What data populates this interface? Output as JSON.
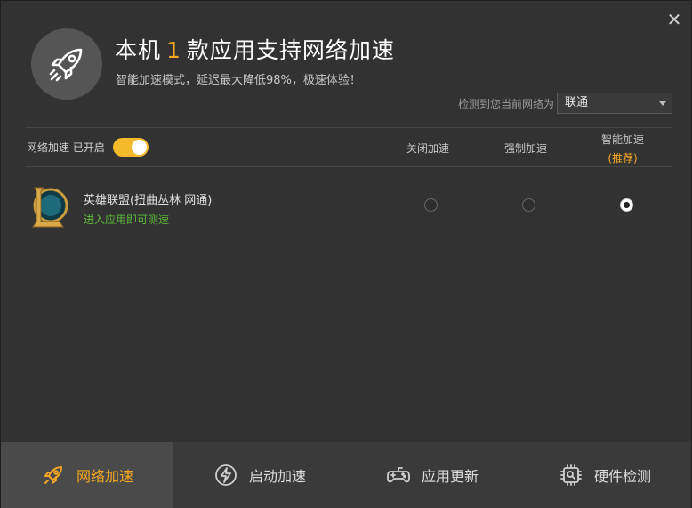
{
  "window": {
    "close_glyph": "✕"
  },
  "hero": {
    "title_prefix": "本机",
    "title_count": "1",
    "title_suffix": "款应用支持网络加速",
    "subtitle": "智能加速模式，延迟最大降低98%，极速体验！",
    "icon": "rocket-icon"
  },
  "network": {
    "label": "检测到您当前网络为",
    "selected": "联通"
  },
  "toggle": {
    "label": "网络加速 已开启",
    "on": true
  },
  "columns": {
    "off": "关闭加速",
    "force": "强制加速",
    "smart": "智能加速",
    "smart_tag": "(推荐)"
  },
  "apps": [
    {
      "name": "英雄联盟(扭曲丛林 网通)",
      "hint": "进入应用即可测速",
      "icon": "league-of-legends-icon",
      "mode": "smart"
    }
  ],
  "nav": {
    "items": [
      {
        "label": "网络加速",
        "icon": "rocket-icon",
        "active": true
      },
      {
        "label": "启动加速",
        "icon": "lightning-icon",
        "active": false
      },
      {
        "label": "应用更新",
        "icon": "gamepad-icon",
        "active": false
      },
      {
        "label": "硬件检测",
        "icon": "chip-icon",
        "active": false
      }
    ]
  },
  "colors": {
    "accent": "#f5a623",
    "toggle": "#f5b92c",
    "hint_green": "#5dbb3a",
    "background": "#323232",
    "nav_bg": "#3a3a3a",
    "nav_active_bg": "#4a4a4a"
  }
}
